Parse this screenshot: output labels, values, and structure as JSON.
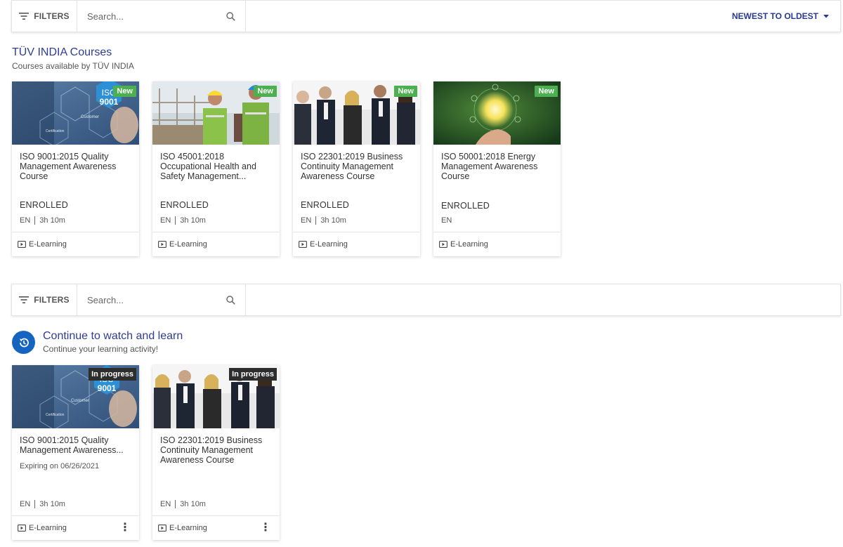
{
  "toolbar1": {
    "filters_label": "FILTERS",
    "search_placeholder": "Search...",
    "sort_label": "NEWEST TO OLDEST"
  },
  "section1": {
    "title": "TÜV INDIA Courses",
    "subtitle": "Courses available by TÜV INDIA",
    "cards": [
      {
        "badge": "New",
        "title": "ISO 9001:2015 Quality Management Awareness Course",
        "status": "ENROLLED",
        "lang": "EN",
        "duration": "3h 10m",
        "type": "E-Learning",
        "thumb": "iso9001"
      },
      {
        "badge": "New",
        "title": "ISO 45001:2018 Occupational Health and Safety Management...",
        "status": "ENROLLED",
        "lang": "EN",
        "duration": "3h 10m",
        "type": "E-Learning",
        "thumb": "workers"
      },
      {
        "badge": "New",
        "title": "ISO 22301:2019 Business Continuity Management Awareness Course",
        "status": "ENROLLED",
        "lang": "EN",
        "duration": "3h 10m",
        "type": "E-Learning",
        "thumb": "business"
      },
      {
        "badge": "New",
        "title": "ISO 50001:2018 Energy Management Awareness Course",
        "status": "ENROLLED",
        "lang": "EN",
        "duration": "",
        "type": "E-Learning",
        "thumb": "energy"
      }
    ]
  },
  "toolbar2": {
    "filters_label": "FILTERS",
    "search_placeholder": "Search..."
  },
  "section2": {
    "title": "Continue to watch and learn",
    "subtitle": "Continue your learning activity!",
    "cards": [
      {
        "badge": "In progress",
        "title": "ISO 9001:2015 Quality Management Awareness...",
        "expiry": "Expiring on 06/26/2021",
        "lang": "EN",
        "duration": "3h 10m",
        "type": "E-Learning",
        "thumb": "iso9001"
      },
      {
        "badge": "In progress",
        "title": "ISO 22301:2019 Business Continuity Management Awareness Course",
        "expiry": "",
        "lang": "EN",
        "duration": "3h 10m",
        "type": "E-Learning",
        "thumb": "business"
      }
    ]
  },
  "thumb_text": {
    "iso_line1": "ISO",
    "iso_line2": "9001",
    "customer": "Customer",
    "certification": "Certification"
  },
  "colors": {
    "accent": "#2e3c96",
    "badge_new": "#4caf50",
    "badge_progress": "#2d2d2d",
    "history_icon_bg": "#1565c0"
  }
}
